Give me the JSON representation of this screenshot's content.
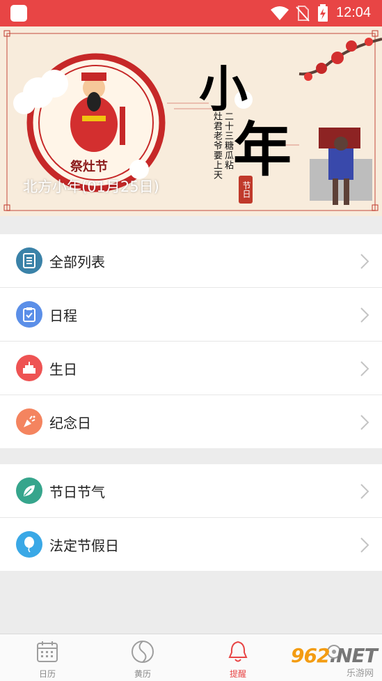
{
  "status_bar": {
    "time": "12:04",
    "icons": [
      "app-icon",
      "wifi-icon",
      "no-sim-icon",
      "battery-charging-icon"
    ]
  },
  "banner": {
    "caption": "北方小年(01月25日)",
    "big_char_1": "小",
    "big_char_2": "年",
    "verse_1": "二十三糖瓜粘",
    "verse_2": "灶君老爷要上天",
    "stamp": "节日",
    "ziban_label": "祭灶节"
  },
  "list_group_1": [
    {
      "label": "全部列表",
      "icon": "list-icon",
      "color": "#3a82a8"
    },
    {
      "label": "日程",
      "icon": "clipboard-check-icon",
      "color": "#5b8fe8"
    },
    {
      "label": "生日",
      "icon": "cake-icon",
      "color": "#ee5353"
    },
    {
      "label": "纪念日",
      "icon": "party-popper-icon",
      "color": "#f4845f"
    }
  ],
  "list_group_2": [
    {
      "label": "节日节气",
      "icon": "leaf-icon",
      "color": "#36a58c"
    },
    {
      "label": "法定节假日",
      "icon": "balloon-icon",
      "color": "#3aa8e6"
    }
  ],
  "bottom_nav": [
    {
      "label": "日历",
      "icon": "calendar-icon",
      "active": false
    },
    {
      "label": "黄历",
      "icon": "yin-yang-icon",
      "active": false
    },
    {
      "label": "提醒",
      "icon": "bell-icon",
      "active": true
    },
    {
      "label": "",
      "icon": "settings-icon",
      "active": false
    }
  ],
  "watermark": {
    "text_main": "962",
    "text_suffix": ".NET",
    "text_sub": "乐游网"
  },
  "colors": {
    "accent": "#e84545",
    "background": "#ececec"
  }
}
